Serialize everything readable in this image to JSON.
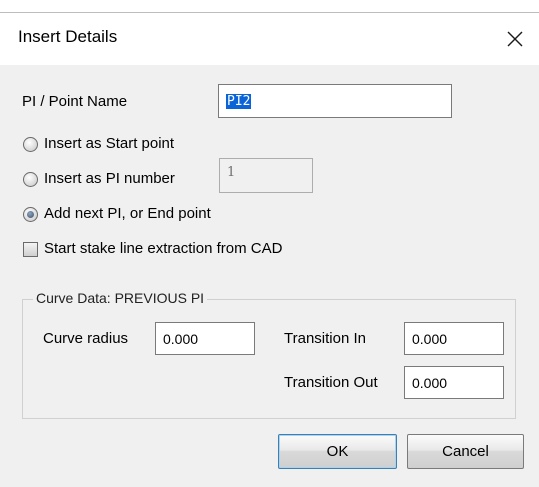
{
  "dialog": {
    "title": "Insert Details",
    "close_glyph": "✕"
  },
  "fields": {
    "point_name_label": "PI / Point Name",
    "point_name_value": "PI2",
    "pi_number_value": "1"
  },
  "options": {
    "start_point_label": "Insert as Start point",
    "pi_number_label": "Insert as PI number",
    "next_pi_label": "Add next PI, or End point",
    "selected": "next_pi"
  },
  "checkbox": {
    "label": "Start stake line extraction from CAD",
    "checked": false
  },
  "curve": {
    "group_title": "Curve Data: PREVIOUS PI",
    "radius_label": "Curve radius",
    "radius_value": "0.000",
    "transition_in_label": "Transition In",
    "transition_in_value": "0.000",
    "transition_out_label": "Transition Out",
    "transition_out_value": "0.000"
  },
  "buttons": {
    "ok_label": "OK",
    "cancel_label": "Cancel"
  },
  "colors": {
    "selection": "#0a64d8",
    "dialog_background": "#f0f0f0",
    "titlebar_background": "#ffffff"
  }
}
